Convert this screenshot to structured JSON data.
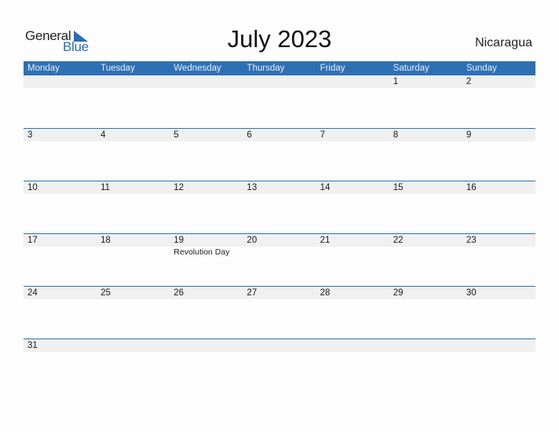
{
  "logo": {
    "word1": "General",
    "word2": "Blue",
    "icon": "triangle-flag-icon",
    "brand_color": "#2a6db5"
  },
  "title": "July 2023",
  "country": "Nicaragua",
  "colors": {
    "header_bg": "#2e70b5",
    "date_strip_bg": "#f0f0f0"
  },
  "weekdays": [
    "Monday",
    "Tuesday",
    "Wednesday",
    "Thursday",
    "Friday",
    "Saturday",
    "Sunday"
  ],
  "weeks": [
    {
      "days": [
        "",
        "",
        "",
        "",
        "",
        "1",
        "2"
      ],
      "holidays": [
        "",
        "",
        "",
        "",
        "",
        "",
        ""
      ]
    },
    {
      "days": [
        "3",
        "4",
        "5",
        "6",
        "7",
        "8",
        "9"
      ],
      "holidays": [
        "",
        "",
        "",
        "",
        "",
        "",
        ""
      ]
    },
    {
      "days": [
        "10",
        "11",
        "12",
        "13",
        "14",
        "15",
        "16"
      ],
      "holidays": [
        "",
        "",
        "",
        "",
        "",
        "",
        ""
      ]
    },
    {
      "days": [
        "17",
        "18",
        "19",
        "20",
        "21",
        "22",
        "23"
      ],
      "holidays": [
        "",
        "",
        "Revolution Day",
        "",
        "",
        "",
        ""
      ]
    },
    {
      "days": [
        "24",
        "25",
        "26",
        "27",
        "28",
        "29",
        "30"
      ],
      "holidays": [
        "",
        "",
        "",
        "",
        "",
        "",
        ""
      ]
    },
    {
      "days": [
        "31",
        "",
        "",
        "",
        "",
        "",
        ""
      ],
      "holidays": [
        "",
        "",
        "",
        "",
        "",
        "",
        ""
      ]
    }
  ]
}
